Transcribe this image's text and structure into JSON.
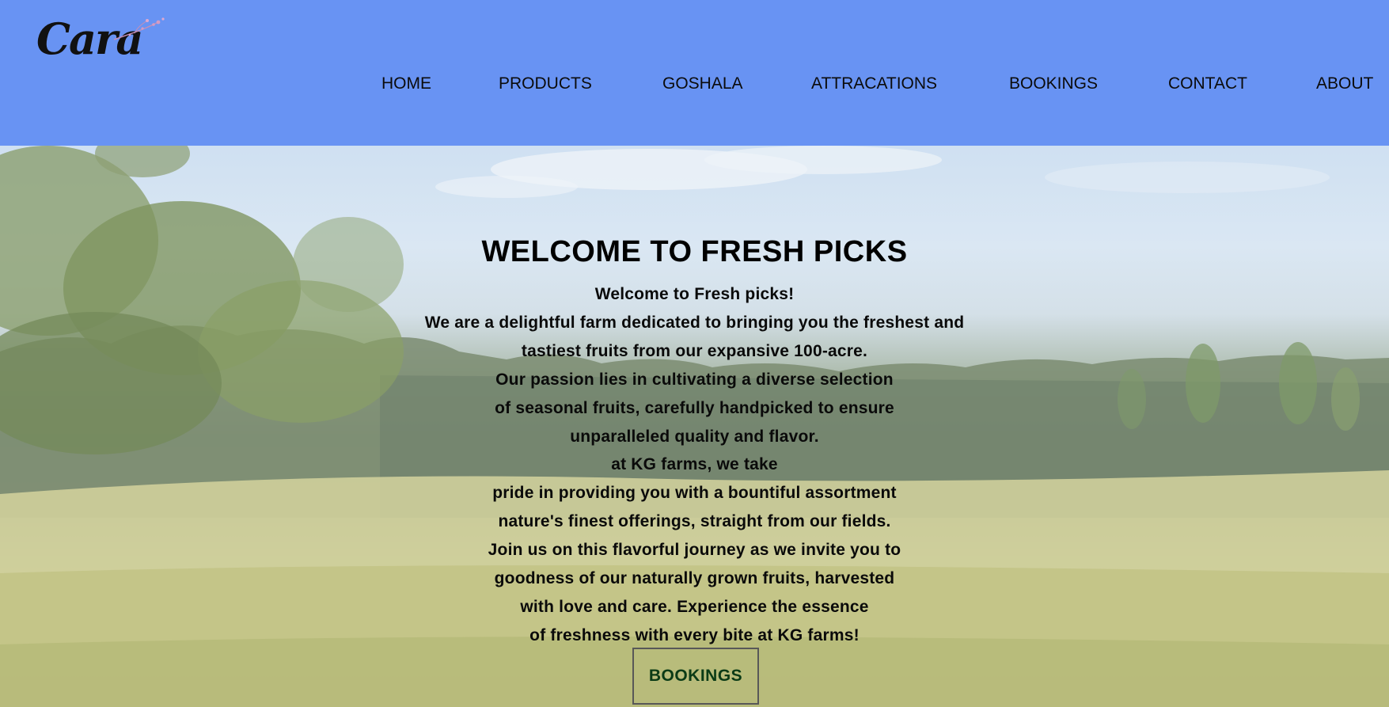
{
  "header": {
    "logo_text": "Cara",
    "nav": [
      {
        "label": "HOME"
      },
      {
        "label": "PRODUCTS"
      },
      {
        "label": "GOSHALA"
      },
      {
        "label": "ATTRACATIONS"
      },
      {
        "label": "BOOKINGS"
      },
      {
        "label": "CONTACT"
      },
      {
        "label": "ABOUT"
      }
    ]
  },
  "hero": {
    "title": "WELCOME TO FRESH PICKS",
    "lines": [
      "Welcome to Fresh picks!",
      "We are a delightful farm dedicated to bringing you the freshest and",
      "tastiest fruits from our expansive 100-acre.",
      "Our passion lies in cultivating a diverse selection",
      "of seasonal fruits, carefully handpicked to ensure",
      "unparalleled quality and flavor.",
      "at KG farms, we take",
      "pride in providing you with a bountiful assortment",
      "nature's finest offerings, straight from our fields.",
      "Join us on this flavorful journey as we invite you to",
      "goodness of our naturally grown fruits, harvested",
      "with love and care. Experience the essence",
      "of freshness with every bite at KG farms!"
    ],
    "button_label": "BOOKINGS"
  },
  "colors": {
    "header_bg": "#6893f3",
    "button_text": "#0b3b16"
  },
  "icons": {
    "logo_flower": "flower-sprig-icon"
  }
}
